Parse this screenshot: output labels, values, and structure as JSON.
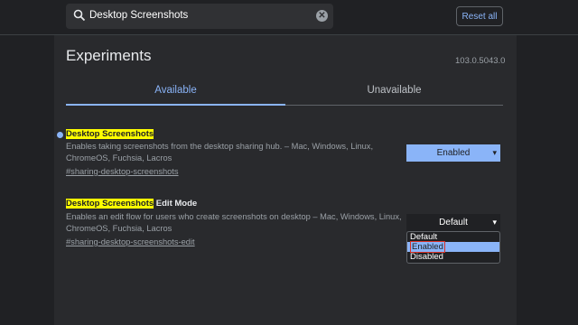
{
  "search": {
    "value": "Desktop Screenshots",
    "clear_icon": "✕"
  },
  "header": {
    "reset_label": "Reset all"
  },
  "page": {
    "title": "Experiments",
    "version": "103.0.5043.0"
  },
  "tabs": [
    {
      "label": "Available"
    },
    {
      "label": "Unavailable"
    }
  ],
  "flags": [
    {
      "name_highlight": "Desktop Screenshots",
      "name_rest": "",
      "desc_line1": "Enables taking screenshots from the desktop sharing hub. – Mac, Windows, Linux,",
      "desc_line2": "ChromeOS, Fuchsia, Lacros",
      "link": "#sharing-desktop-screenshots",
      "select_value": "Enabled"
    },
    {
      "name_highlight": "Desktop Screenshots",
      "name_rest": " Edit Mode",
      "desc_line1": "Enables an edit flow for users who create screenshots on desktop – Mac, Windows, Linux,",
      "desc_line2": "ChromeOS, Fuchsia, Lacros",
      "link": "#sharing-desktop-screenshots-edit",
      "select_value": "Default",
      "options": [
        "Default",
        "Enabled",
        "Disabled"
      ]
    }
  ],
  "icons": {
    "search": "search-icon",
    "chevron": "▾"
  },
  "colors": {
    "accent": "#8ab4f8",
    "highlight": "#ffff00",
    "background": "#202124",
    "panel": "#292a2d"
  }
}
